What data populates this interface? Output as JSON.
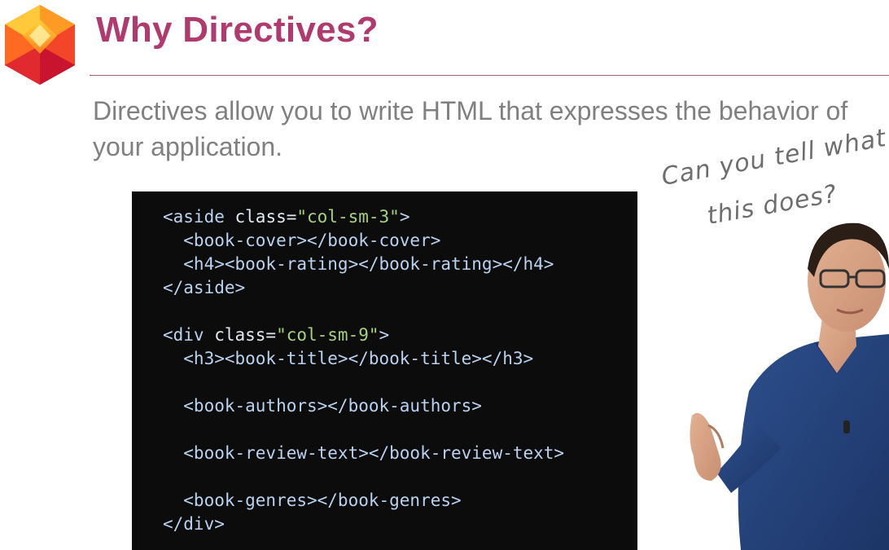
{
  "slide": {
    "title": "Why Directives?",
    "lead": "Directives allow you to write HTML that expresses the behavior of your application.",
    "note": {
      "line1": "Can you tell what",
      "line2": "this does?"
    },
    "icons": {
      "logo": "gem-logo-icon"
    },
    "colors": {
      "title": "#b03a6e",
      "lead": "#808080",
      "code_background": "#0c0c0c",
      "code_tag": "#b9d2f0",
      "code_string": "#a6d37f"
    },
    "code_lines": [
      [
        {
          "k": "t",
          "v": "<aside "
        },
        {
          "k": "a",
          "v": "class="
        },
        {
          "k": "s",
          "v": "\"col-sm-3\""
        },
        {
          "k": "t",
          "v": ">"
        }
      ],
      [
        {
          "k": "t",
          "v": "  <book-cover></book-cover>"
        }
      ],
      [
        {
          "k": "t",
          "v": "  <h4><book-rating></book-rating></h4>"
        }
      ],
      [
        {
          "k": "t",
          "v": "</aside>"
        }
      ],
      [],
      [
        {
          "k": "t",
          "v": "<div "
        },
        {
          "k": "a",
          "v": "class="
        },
        {
          "k": "s",
          "v": "\"col-sm-9\""
        },
        {
          "k": "t",
          "v": ">"
        }
      ],
      [
        {
          "k": "t",
          "v": "  <h3><book-title></book-title></h3>"
        }
      ],
      [],
      [
        {
          "k": "t",
          "v": "  <book-authors></book-authors>"
        }
      ],
      [],
      [
        {
          "k": "t",
          "v": "  <book-review-text></book-review-text>"
        }
      ],
      [],
      [
        {
          "k": "t",
          "v": "  <book-genres></book-genres>"
        }
      ],
      [
        {
          "k": "t",
          "v": "</div>"
        }
      ]
    ]
  }
}
